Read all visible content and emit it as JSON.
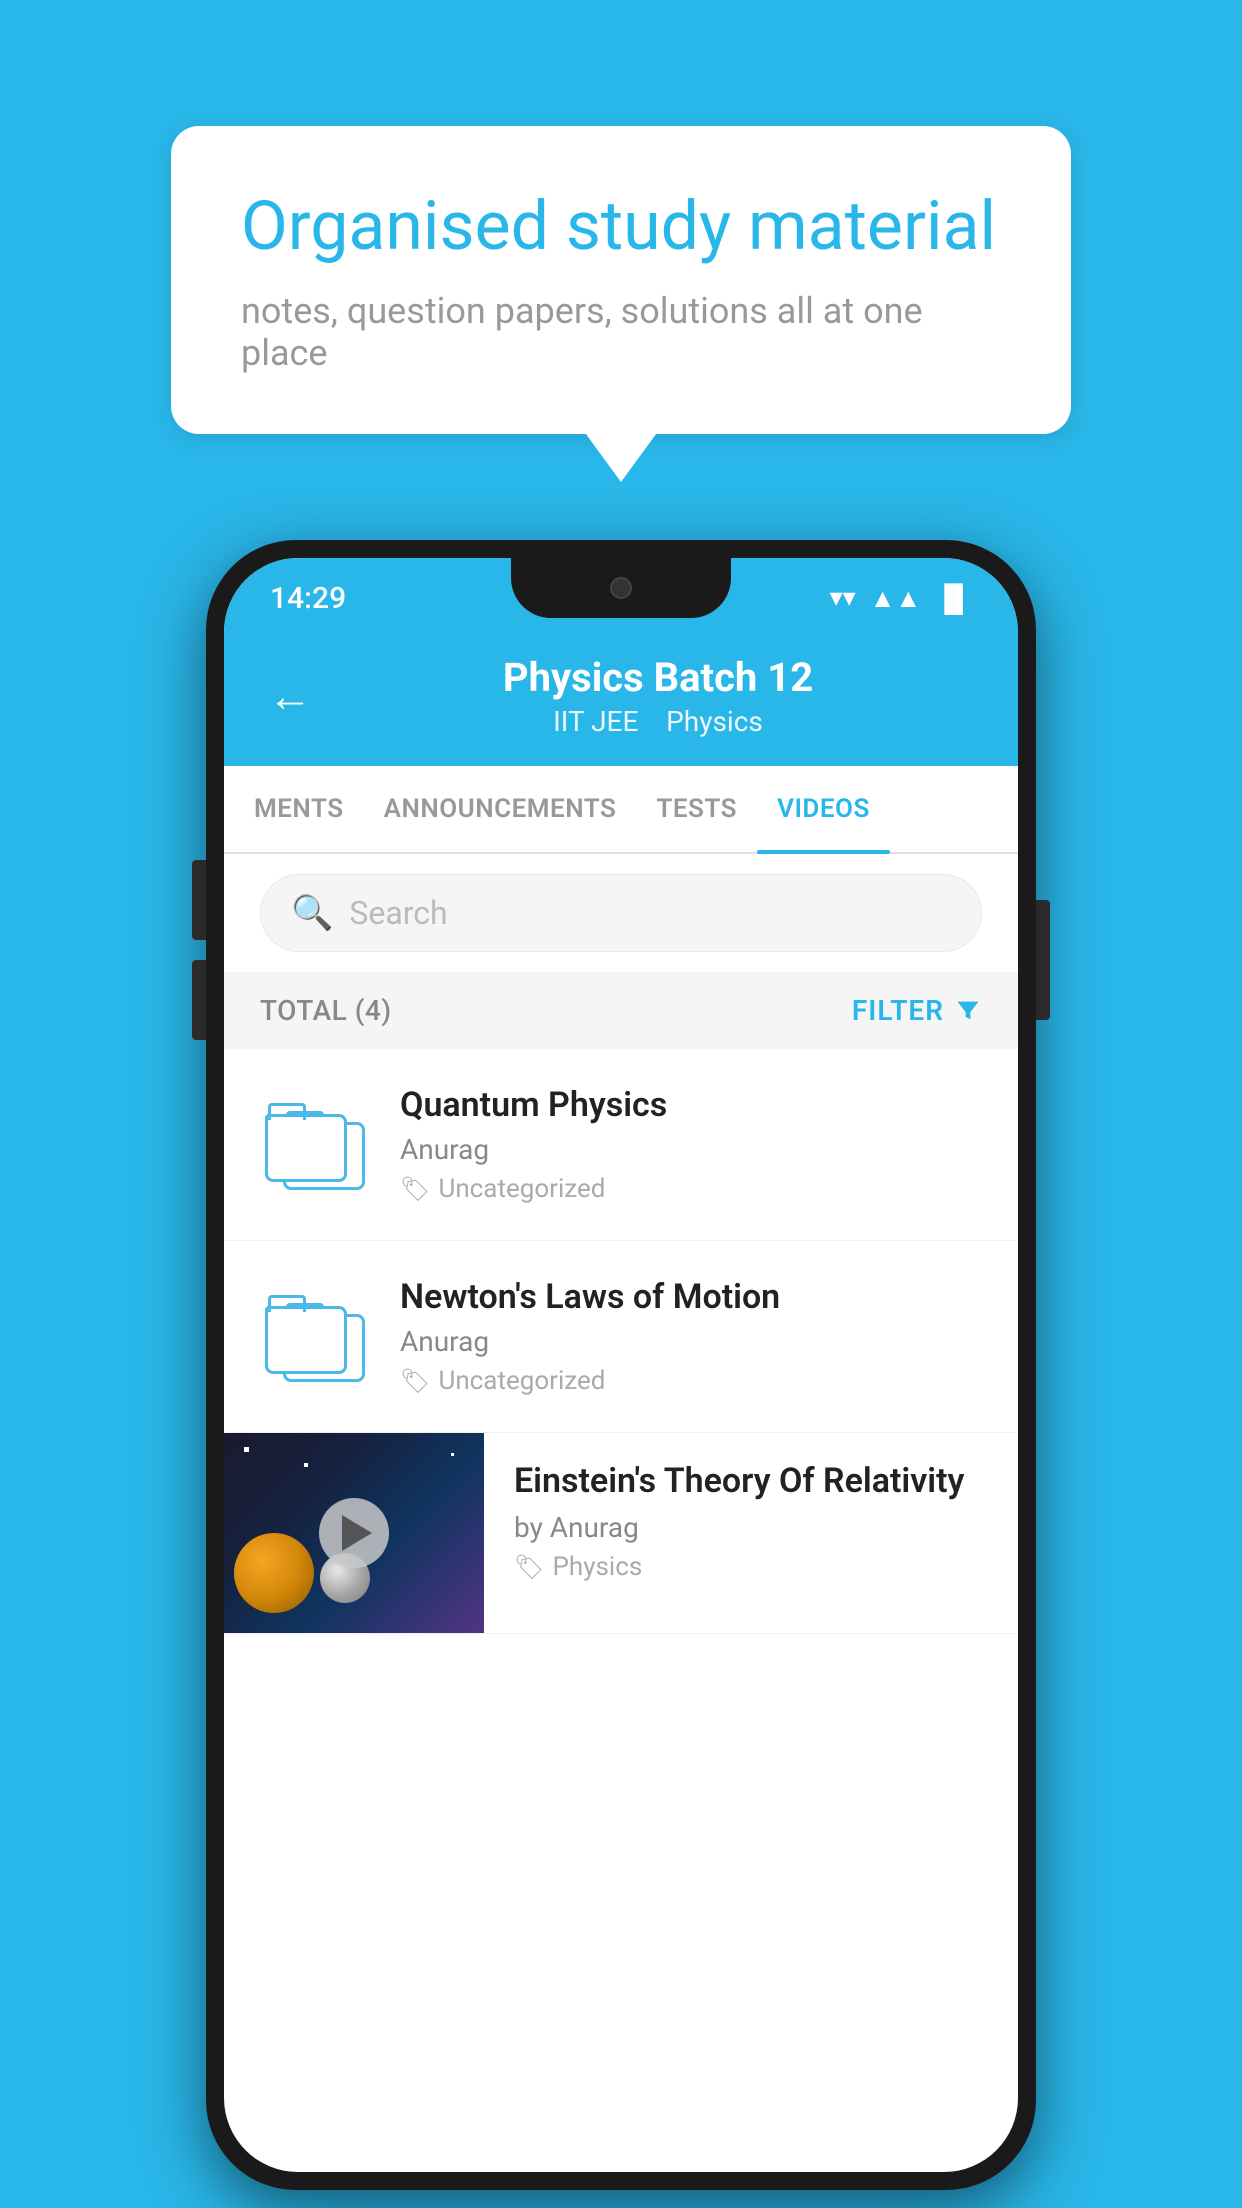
{
  "background_color": "#29b6e8",
  "speech_bubble": {
    "title": "Organised study material",
    "subtitle": "notes, question papers, solutions all at one place"
  },
  "status_bar": {
    "time": "14:29",
    "wifi": "▼",
    "signal": "▲",
    "battery": "▐"
  },
  "app_header": {
    "back_label": "←",
    "title": "Physics Batch 12",
    "subtitle_part1": "IIT JEE",
    "subtitle_part2": "Physics"
  },
  "tabs": [
    {
      "label": "MENTS",
      "active": false
    },
    {
      "label": "ANNOUNCEMENTS",
      "active": false
    },
    {
      "label": "TESTS",
      "active": false
    },
    {
      "label": "VIDEOS",
      "active": true
    }
  ],
  "search": {
    "placeholder": "Search"
  },
  "filter_row": {
    "total_label": "TOTAL (4)",
    "filter_label": "FILTER"
  },
  "videos": [
    {
      "id": 1,
      "title": "Quantum Physics",
      "author": "Anurag",
      "tag": "Uncategorized",
      "has_thumbnail": false
    },
    {
      "id": 2,
      "title": "Newton's Laws of Motion",
      "author": "Anurag",
      "tag": "Uncategorized",
      "has_thumbnail": false
    },
    {
      "id": 3,
      "title": "Einstein's Theory Of Relativity",
      "author": "by Anurag",
      "tag": "Physics",
      "has_thumbnail": true
    }
  ]
}
